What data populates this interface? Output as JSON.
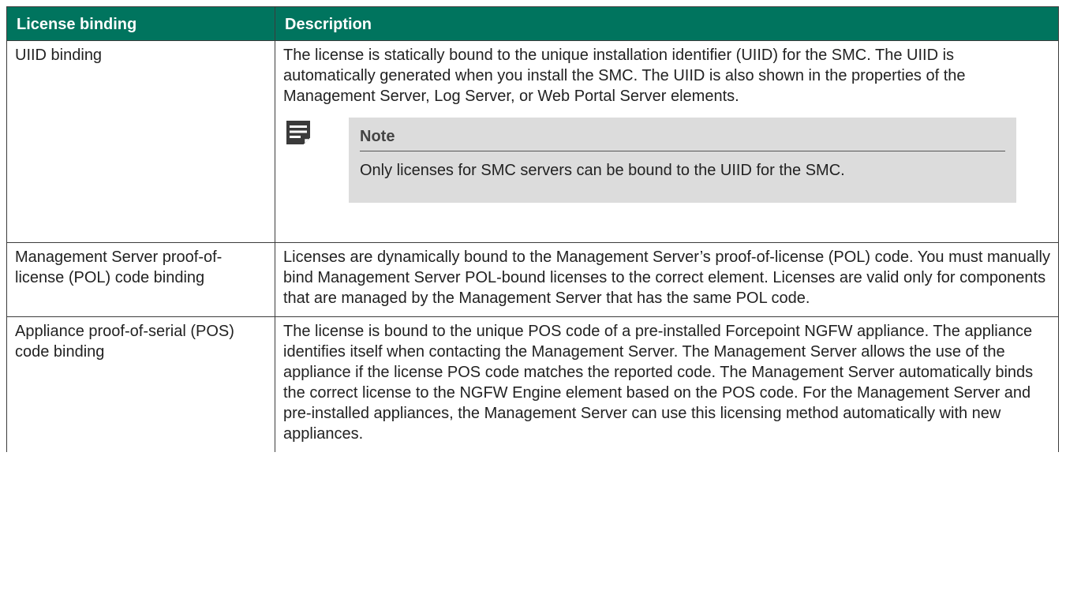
{
  "table": {
    "headers": [
      "License binding",
      "Description"
    ],
    "rows": [
      {
        "binding": "UIID binding",
        "description": "The license is statically bound to the unique installation identifier (UIID) for the SMC. The UIID is automatically generated when you install the SMC. The UIID is also shown in the properties of the Management Server, Log Server, or Web Portal Server elements.",
        "note": {
          "icon": "note-icon",
          "title": "Note",
          "text": "Only licenses for SMC servers can be bound to the UIID for the SMC."
        }
      },
      {
        "binding": "Management Server proof-of-license (POL) code binding",
        "description": "Licenses are dynamically bound to the Management Server’s proof-of-license (POL) code. You must manually bind Management Server POL-bound licenses to the correct element. Licenses are valid only for components that are managed by the Management Server that has the same POL code."
      },
      {
        "binding": "Appliance proof-of-serial (POS) code binding",
        "description": "The license is bound to the unique POS code of a pre-installed Forcepoint NGFW appliance. The appliance identifies itself when contacting the Management Server. The Management Server allows the use of the appliance if the license POS code matches the reported code. The Management Server automatically binds the correct license to the NGFW Engine element based on the POS code. For the Management Server and pre-installed appliances, the Management Server can use this licensing method automatically with new appliances."
      }
    ]
  },
  "colors": {
    "header_bg": "#00745e",
    "header_text": "#ffffff",
    "note_bg": "#dcdcdc",
    "border": "#3c3c3c"
  }
}
